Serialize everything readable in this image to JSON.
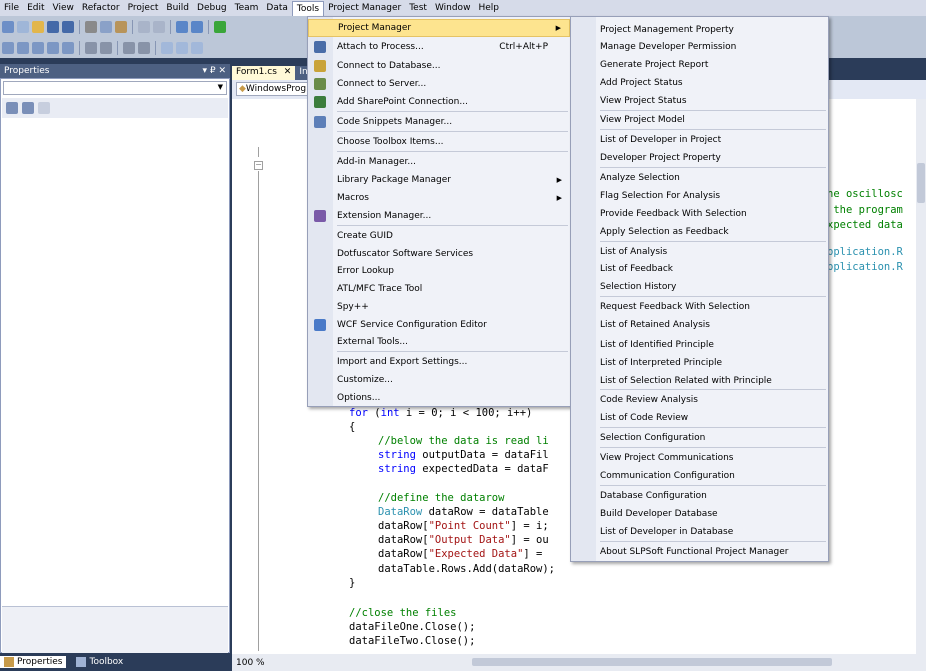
{
  "menubar": {
    "items": [
      "File",
      "Edit",
      "View",
      "Refactor",
      "Project",
      "Build",
      "Debug",
      "Team",
      "Data",
      "Tools",
      "Project Manager",
      "Test",
      "Window",
      "Help"
    ],
    "open_item": "Tools"
  },
  "properties": {
    "title": "Properties",
    "pin": "▾ ₽ ✕",
    "bottom_tabs": [
      "Properties",
      "Toolbox"
    ]
  },
  "editor": {
    "tabs": [
      "Form1.cs",
      "Ins"
    ],
    "nav_left": "WindowsProg",
    "zoom": "100 %",
    "code_right": [
      "he oscillosc",
      " the program",
      "xpected data",
      "",
      "pplication.R",
      "pplication.R"
    ],
    "code": {
      "for_line": [
        "for",
        " (",
        "int",
        " i = 0; i < 100; i++)"
      ],
      "brace_open": "{",
      "comment1": "//below the data is read li",
      "line_string1": [
        "string",
        " outputData = dataFil"
      ],
      "line_string2": [
        "string",
        " expectedData = dataF"
      ],
      "comment2": "//define the datarow",
      "line_datarow": [
        "DataRow",
        " dataRow = dataTable"
      ],
      "line_dr1": [
        "dataRow[",
        "\"Point Count\"",
        "] = i;"
      ],
      "line_dr2": [
        "dataRow[",
        "\"Output Data\"",
        "] = ou"
      ],
      "line_dr3": [
        "dataRow[",
        "\"Expected Data\"",
        "] ="
      ],
      "line_add": "dataTable.Rows.Add(dataRow);",
      "brace_close": "}",
      "comment3": "//close the files",
      "close1": "dataFileOne.Close();",
      "close2": "dataFileTwo.Close();"
    }
  },
  "tools_menu": {
    "items": [
      {
        "label": "Project Manager",
        "arrow": "▶",
        "highlight": true
      },
      {
        "label": "Attach to Process...",
        "shortcut": "Ctrl+Alt+P",
        "icon": "attach-icon"
      },
      {
        "label": "Connect to Database...",
        "icon": "database-icon"
      },
      {
        "label": "Connect to Server...",
        "icon": "server-icon"
      },
      {
        "label": "Add SharePoint Connection...",
        "icon": "sharepoint-icon"
      },
      {
        "label": "Code Snippets Manager...",
        "icon": "snippets-icon"
      },
      {
        "label": "Choose Toolbox Items..."
      },
      {
        "label": "Add-in Manager..."
      },
      {
        "label": "Library Package Manager",
        "arrow": "▶"
      },
      {
        "label": "Macros",
        "arrow": "▶"
      },
      {
        "label": "Extension Manager...",
        "icon": "extension-icon"
      },
      {
        "label": "Create GUID"
      },
      {
        "label": "Dotfuscator Software Services"
      },
      {
        "label": "Error Lookup"
      },
      {
        "label": "ATL/MFC Trace Tool"
      },
      {
        "label": "Spy++"
      },
      {
        "label": "WCF Service Configuration Editor",
        "icon": "wcf-icon"
      },
      {
        "label": "External Tools..."
      },
      {
        "label": "Import and Export Settings..."
      },
      {
        "label": "Customize..."
      },
      {
        "label": "Options..."
      }
    ]
  },
  "project_manager_menu": {
    "items": [
      "Project Management Property",
      "Manage Developer Permission",
      "Generate Project Report",
      "Add Project Status",
      "View Project Status",
      "View Project Model",
      "List of Developer in Project",
      "Developer Project Property",
      "Analyze Selection",
      "Flag Selection For Analysis",
      "Provide Feedback With Selection",
      "Apply Selection as Feedback",
      "List of Analysis",
      "List of Feedback",
      "Selection History",
      "Request Feedback With Selection",
      "List of Retained Analysis",
      "List of Identified Principle",
      "List of Interpreted Principle",
      "List of Selection Related with Principle",
      "Code Review Analysis",
      "List of Code Review",
      "Selection Configuration",
      "View Project Communications",
      "Communication Configuration",
      "Database Configuration",
      "Build Developer Database",
      "List of Developer in Database",
      "About SLPSoft Functional Project Manager"
    ]
  },
  "colors": {
    "accent": "#fde48f",
    "ide_background": "#2b3c59",
    "menu_background": "#f0f2f8"
  }
}
